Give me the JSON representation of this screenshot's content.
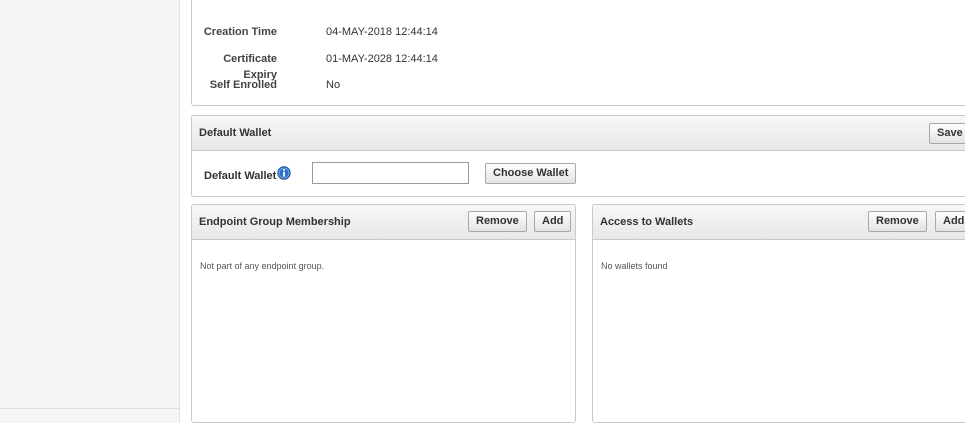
{
  "details": {
    "creation_time": {
      "label": "Creation Time",
      "value": "04-MAY-2018 12:44:14"
    },
    "certificate_expiry": {
      "label": "Certificate Expiry",
      "value": "01-MAY-2028 12:44:14"
    },
    "self_enrolled": {
      "label": "Self Enrolled",
      "value": "No"
    }
  },
  "default_wallet_panel": {
    "title": "Default Wallet",
    "save_label": "Save",
    "field_label": "Default Wallet",
    "field_value": "",
    "info_icon": "info-icon",
    "choose_label": "Choose Wallet"
  },
  "endpoint_group_panel": {
    "title": "Endpoint Group Membership",
    "remove_label": "Remove",
    "add_label": "Add",
    "empty_text": "Not part of any endpoint group."
  },
  "wallets_panel": {
    "title": "Access to Wallets",
    "remove_label": "Remove",
    "add_label": "Add",
    "empty_text": "No wallets found"
  }
}
